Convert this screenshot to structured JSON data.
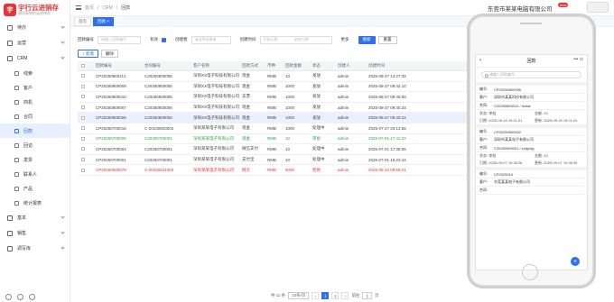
{
  "app": {
    "logo_mark": "宇",
    "logo_title": "宇行云进销存",
    "logo_sub": "通用高效的云进销存",
    "company": "东莞市某某电脑有限公司",
    "new_badge": "new"
  },
  "sidebar": {
    "items": [
      {
        "label": "待办",
        "icon": "todo-icon",
        "sub": false,
        "active": false
      },
      {
        "label": "运营",
        "icon": "ops-icon",
        "sub": false,
        "active": false
      },
      {
        "label": "CRM",
        "icon": "crm-icon",
        "sub": false,
        "active": false
      },
      {
        "label": "线索",
        "icon": "lead-icon",
        "sub": true,
        "active": false
      },
      {
        "label": "客户",
        "icon": "customer-icon",
        "sub": true,
        "active": false
      },
      {
        "label": "商机",
        "icon": "opportunity-icon",
        "sub": true,
        "active": false
      },
      {
        "label": "合同",
        "icon": "contract-icon",
        "sub": true,
        "active": false
      },
      {
        "label": "回款",
        "icon": "payment-icon",
        "sub": true,
        "active": true
      },
      {
        "label": "回访",
        "icon": "visit-icon",
        "sub": true,
        "active": false
      },
      {
        "label": "发票",
        "icon": "invoice-icon",
        "sub": true,
        "active": false
      },
      {
        "label": "联系人",
        "icon": "contact-icon",
        "sub": true,
        "active": false
      },
      {
        "label": "产品",
        "icon": "product-icon",
        "sub": true,
        "active": false
      },
      {
        "label": "统计报表",
        "icon": "report-icon",
        "sub": true,
        "active": false
      },
      {
        "label": "基本",
        "icon": "base-icon",
        "sub": false,
        "active": false
      },
      {
        "label": "销售",
        "icon": "sales-icon",
        "sub": false,
        "active": false
      },
      {
        "label": "调写库",
        "icon": "warehouse-icon",
        "sub": false,
        "active": false
      }
    ]
  },
  "breadcrumb": {
    "home": "首页",
    "crm": "CRM",
    "current": "回款"
  },
  "tabs": [
    {
      "label": "首页"
    },
    {
      "label": "回款 ×"
    }
  ],
  "search": {
    "code_label": "回款编号",
    "code_placeholder": "请输入回款编号",
    "valid_label": "有效",
    "creator_label": "创建者",
    "creator_placeholder": "请选择创建者",
    "time_label": "创建时间",
    "start_placeholder": "开始日期",
    "sep": "~",
    "end_placeholder": "结束日期",
    "more_label": "更多",
    "search_btn": "搜索",
    "reset_btn": "重置"
  },
  "toolbar": {
    "add": "+ 新增",
    "delete": "删除"
  },
  "table": {
    "headers": [
      "回款编号",
      "合同编号",
      "客户名称",
      "回款方式",
      "币种",
      "回款金额",
      "状态",
      "创建人",
      "创建时间"
    ],
    "rows": [
      {
        "tone": "normal",
        "cells": [
          "CP20250900112",
          "C20250800006",
          "深圳XX电子科技有限公司",
          "现金",
          "RMB",
          "10",
          "发放",
          "admin",
          "2025-08-27 14:27:32"
        ]
      },
      {
        "tone": "normal",
        "cells": [
          "CP20250800009",
          "C20250800006",
          "深圳XX电子科技有限公司",
          "现金",
          "RMB",
          "1000",
          "发放",
          "admin",
          "2025-08-27 09:44:10"
        ]
      },
      {
        "tone": "normal",
        "cells": [
          "CP20250800010",
          "C20250800006",
          "深圳XX电子科技有限公司",
          "支票",
          "RMB",
          "1000",
          "发放",
          "admin",
          "2025-08-27 09:45:55"
        ]
      },
      {
        "tone": "normal",
        "cells": [
          "CP20250800007",
          "C20250800006",
          "深圳XX电子科技有限公司",
          "现金",
          "RMB",
          "1000",
          "发放",
          "admin",
          "2025-08-27 09:40:34"
        ]
      },
      {
        "tone": "shaded",
        "cells": [
          "CP20250800005",
          "C20250800006",
          "深圳XX电子科技有限公司",
          "现金",
          "RMB",
          "1000",
          "发放",
          "admin",
          "2025-08-27 09:33:24"
        ]
      },
      {
        "tone": "normal",
        "cells": [
          "CP20250700016",
          "C-20230603002",
          "深圳某某电子有限公司",
          "现金",
          "RMB",
          "1000",
          "处理中",
          "admin",
          "2025-07-27 20:13:56"
        ]
      },
      {
        "tone": "green",
        "cells": [
          "CP20250700006",
          "C20250700001",
          "深圳某某电子有限公司",
          "现金",
          "RMB",
          "10",
          "审批",
          "admin",
          "2025-07-01 17:41:22"
        ]
      },
      {
        "tone": "normal",
        "cells": [
          "CP20250700004",
          "C20250700001",
          "深圳某某电子有限公司",
          "微信支付",
          "RMB",
          "10",
          "处理中",
          "admin",
          "2025-07-01 17:38:05"
        ]
      },
      {
        "tone": "normal",
        "cells": [
          "CP20250700001",
          "C20250700001",
          "深圳某某电子有限公司",
          "支付宝",
          "RMB",
          "10",
          "处理中",
          "admin",
          "2025-07-01 16:22:44"
        ]
      },
      {
        "tone": "red",
        "cells": [
          "CP20250500078",
          "C-20250521002",
          "深圳某某电子有限公司",
          "网页",
          "RMB",
          "5000",
          "拒绝",
          "admin",
          "2025-05-22 09:59:41"
        ]
      }
    ]
  },
  "pager": {
    "total": "共 11 条",
    "size": "10条/页",
    "prev": "‹",
    "pages": [
      "1",
      "2"
    ],
    "next": "›",
    "goto": "前往",
    "goto_val": "1",
    "page_unit": "页"
  },
  "phone": {
    "title": "回款",
    "search_placeholder": "请输入回款编号",
    "cards": [
      {
        "code_label": "编号:",
        "code": "CP20250800006",
        "cust_label": "客户:",
        "cust": "深圳市某某科技有限公司",
        "co_label": "合同:",
        "co": "C20250800010 / dvbaf",
        "a_label": "状态:",
        "a": "审批",
        "b_label": "金额:",
        "b": "10",
        "c_label": "日期:",
        "c": "2025-09-16 19:21:01",
        "d_label": "更新:",
        "d": "2025-09-16 19:21:01"
      },
      {
        "code_label": "编号:",
        "code": "CP20250800002",
        "cust_label": "客户:",
        "cust": "深圳市某某电子有限公司",
        "co_label": "合同:",
        "co": "C20250900001 / zzfgvdg",
        "a_label": "状态:",
        "a": "审批",
        "b_label": "金额:",
        "b": "10",
        "c_label": "日期:",
        "c": "2025-09-07 19:35:26",
        "d_label": "更新:",
        "d": "2025-09-07 19:35:26"
      },
      {
        "code_label": "编号:",
        "code": "CP2025010",
        "cust_label": "客户:",
        "cust": "东莞某某电子有限公司",
        "co_label": "合同:",
        "co": "",
        "a_label": "",
        "a": "",
        "b_label": "",
        "b": "",
        "c_label": "",
        "c": "",
        "d_label": "",
        "d": ""
      }
    ],
    "fab": "+"
  }
}
